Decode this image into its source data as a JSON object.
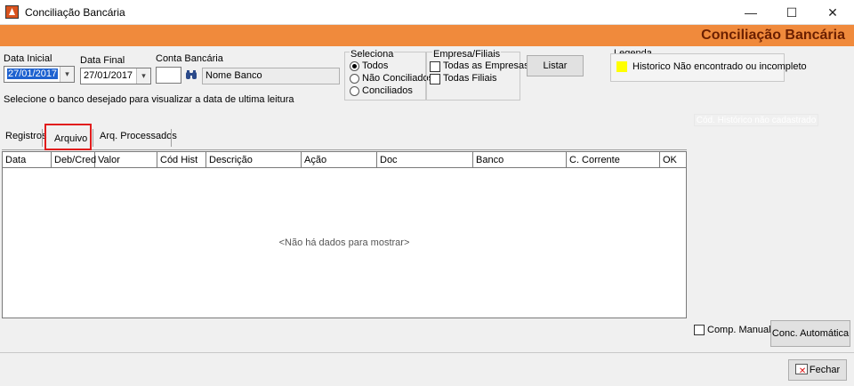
{
  "window": {
    "title": "Conciliação Bancária",
    "minimize": "—",
    "maximize": "☐",
    "close": "✕"
  },
  "header": {
    "title": "Conciliação Bancária"
  },
  "filters": {
    "data_inicial_label": "Data Inicial",
    "data_inicial_value": "27/01/2017",
    "data_final_label": "Data Final",
    "data_final_value": "27/01/2017",
    "conta_bancaria_label": "Conta Bancária",
    "conta_bancaria_value": "",
    "nome_banco": "Nome Banco",
    "hint": "Selecione o banco desejado para visualizar a data de ultima leitura",
    "combo_arrow": "▾"
  },
  "seleciona": {
    "title": "Seleciona",
    "options": [
      "Todos",
      "Não Conciliados",
      "Conciliados"
    ],
    "selected_index": 0
  },
  "empresa": {
    "title": "Empresa/Filiais",
    "options": [
      "Todas as Empresas",
      "Todas Filiais"
    ]
  },
  "listar_label": "Listar",
  "legenda": {
    "title": "Legenda",
    "item": "Historico Não encontrado ou incompleto",
    "color": "#ffff00"
  },
  "faded_tab": "Cód. Histórico não cadastrado",
  "tabs": [
    "Registros",
    "Arquivo",
    "Arq. Processados"
  ],
  "active_tab": 1,
  "grid": {
    "columns": [
      "Data",
      "Deb/Cred",
      "Valor",
      "Cód Hist",
      "Descrição",
      "Ação",
      "Doc",
      "Banco",
      "C. Corrente",
      "OK"
    ],
    "empty_message": "<Não há dados para mostrar>"
  },
  "comp_manual_label": "Comp. Manual",
  "conc_automatica_label": "Conc. Automática",
  "fechar_label": "Fechar",
  "colors": {
    "accent_orange": "#f08a3c",
    "header_text": "#6b1f00",
    "highlight_red": "#e11d1d"
  }
}
